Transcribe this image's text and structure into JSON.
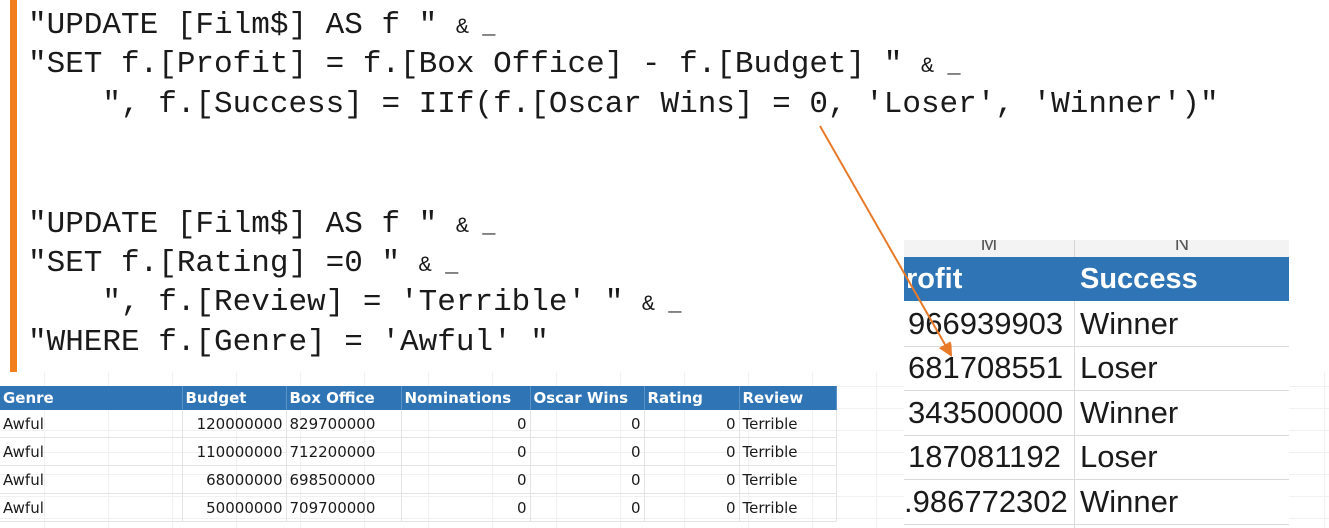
{
  "code": {
    "lines": [
      "\"UPDATE [Film$] AS f \" ",
      "\"SET f.[Profit] = f.[Box Office] - f.[Budget] \" ",
      "    \", f.[Success] = IIf(f.[Oscar Wins] = 0, 'Loser', 'Winner')\"",
      "\"UPDATE [Film$] AS f \" ",
      "\"SET f.[Rating] =0 \" ",
      "    \", f.[Review] = 'Terrible' \" ",
      "\"WHERE f.[Genre] = 'Awful' \""
    ],
    "continuation": "& _"
  },
  "table": {
    "headers": [
      "Genre",
      "Budget",
      "Box Office",
      "Nominations",
      "Oscar Wins",
      "Rating",
      "Review"
    ],
    "rows": [
      [
        "Awful",
        "120000000",
        "829700000",
        "0",
        "0",
        "0",
        "Terrible"
      ],
      [
        "Awful",
        "110000000",
        "712200000",
        "0",
        "0",
        "0",
        "Terrible"
      ],
      [
        "Awful",
        "68000000",
        "698500000",
        "0",
        "0",
        "0",
        "Terrible"
      ],
      [
        "Awful",
        "50000000",
        "709700000",
        "0",
        "0",
        "0",
        "Terrible"
      ]
    ]
  },
  "zoom": {
    "col_letters": [
      "M",
      "N"
    ],
    "headers": [
      "rofit",
      "Success"
    ],
    "rows": [
      [
        "966939903",
        "Winner"
      ],
      [
        "681708551",
        "Loser"
      ],
      [
        "343500000",
        "Winner"
      ],
      [
        "187081192",
        "Loser"
      ],
      ".986772302|Winner"
    ]
  },
  "colors": {
    "accent_bar": "#f07f1c",
    "arrow": "#e87a2a",
    "header_blue": "#2f75b5"
  }
}
